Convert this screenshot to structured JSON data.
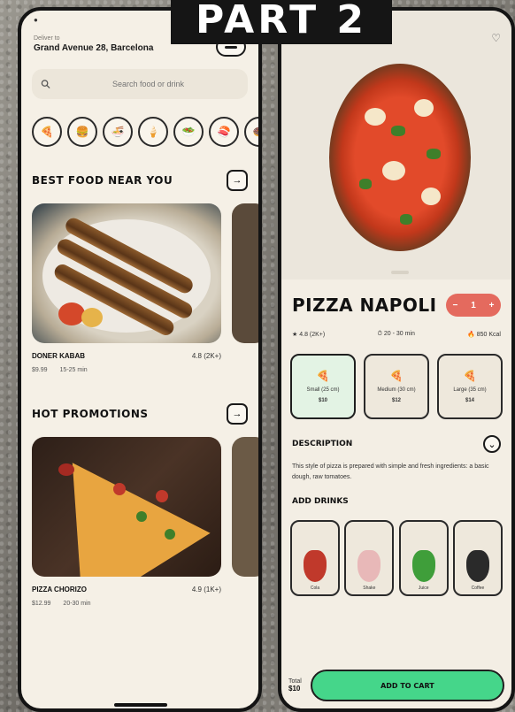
{
  "banner": {
    "text": "PART 2"
  },
  "left": {
    "location_label": "Deliver to",
    "location_value": "Grand Avenue 28, Barcelona",
    "search_placeholder": "Search food or drink",
    "categories": [
      "🍕",
      "🍔",
      "🍜",
      "🍦",
      "🥗",
      "🍣",
      "🍩"
    ],
    "section1": {
      "title": "BEST FOOD NEAR YOU",
      "card": {
        "name": "DONER KABAB",
        "rating": "4.8 (2K+)",
        "price": "$9.99",
        "time": "15-25 min"
      }
    },
    "section2": {
      "title": "HOT PROMOTIONS",
      "card": {
        "name": "PIZZA CHORIZO",
        "rating": "4.9 (1K+)",
        "price": "$12.99",
        "time": "20-30 min"
      }
    }
  },
  "right": {
    "product_name": "PIZZA NAPOLI",
    "stepper": {
      "minus": "−",
      "qty": "1",
      "plus": "+"
    },
    "stats": [
      "4.8 (2K+)",
      "20 - 30 min",
      "850 Kcal"
    ],
    "sizes": [
      {
        "label": "Small (25 cm)",
        "price": "$10",
        "active": true
      },
      {
        "label": "Medium (30 cm)",
        "price": "$12",
        "active": false
      },
      {
        "label": "Large (35 cm)",
        "price": "$14",
        "active": false
      }
    ],
    "description_title": "DESCRIPTION",
    "description": "This style of pizza is prepared with simple and fresh ingredients: a basic dough, raw tomatoes.",
    "drinks_title": "ADD DRINKS",
    "drinks": [
      {
        "name": "Cola",
        "color": "#c0392b"
      },
      {
        "name": "Shake",
        "color": "#e8b8b8"
      },
      {
        "name": "Juice",
        "color": "#3f9e3a"
      },
      {
        "name": "Coffee",
        "color": "#2a2a2a"
      }
    ],
    "total_label": "Total",
    "total_value": "$10",
    "cta": "ADD TO CART"
  }
}
